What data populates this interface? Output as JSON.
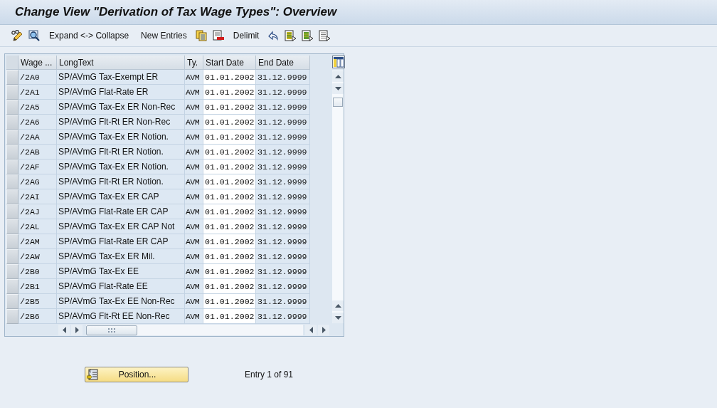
{
  "window": {
    "title": "Change View \"Derivation of Tax Wage Types\": Overview"
  },
  "toolbar": [
    "Expand <-> Collapse",
    "New Entries",
    "Delimit"
  ],
  "table": {
    "columns": [
      {
        "label": "Wage ...",
        "input": false
      },
      {
        "label": "LongText",
        "input": false
      },
      {
        "label": "Ty.",
        "input": false
      },
      {
        "label": "Start Date",
        "input": true
      },
      {
        "label": "End Date",
        "input": false
      }
    ],
    "rows": [
      {
        "selected": false,
        "cells": [
          "/2A0",
          "SP/AVmG Tax-Exempt ER",
          "AVM",
          "01.01.2002",
          "31.12.9999"
        ]
      },
      {
        "selected": false,
        "cells": [
          "/2A1",
          "SP/AVmG Flat-Rate ER",
          "AVM",
          "01.01.2002",
          "31.12.9999"
        ]
      },
      {
        "selected": false,
        "cells": [
          "/2A5",
          "SP/AVmG Tax-Ex ER Non-Rec",
          "AVM",
          "01.01.2002",
          "31.12.9999"
        ]
      },
      {
        "selected": false,
        "cells": [
          "/2A6",
          "SP/AVmG Flt-Rt ER Non-Rec",
          "AVM",
          "01.01.2002",
          "31.12.9999"
        ]
      },
      {
        "selected": false,
        "cells": [
          "/2AA",
          "SP/AVmG Tax-Ex ER Notion.",
          "AVM",
          "01.01.2002",
          "31.12.9999"
        ]
      },
      {
        "selected": false,
        "cells": [
          "/2AB",
          "SP/AVmG Flt-Rt ER Notion.",
          "AVM",
          "01.01.2002",
          "31.12.9999"
        ]
      },
      {
        "selected": false,
        "cells": [
          "/2AF",
          "SP/AVmG Tax-Ex ER Notion.",
          "AVM",
          "01.01.2002",
          "31.12.9999"
        ]
      },
      {
        "selected": false,
        "cells": [
          "/2AG",
          "SP/AVmG Flt-Rt ER Notion.",
          "AVM",
          "01.01.2002",
          "31.12.9999"
        ]
      },
      {
        "selected": false,
        "cells": [
          "/2AI",
          "SP/AVmG Tax-Ex ER CAP",
          "AVM",
          "01.01.2002",
          "31.12.9999"
        ]
      },
      {
        "selected": false,
        "cells": [
          "/2AJ",
          "SP/AVmG Flat-Rate ER CAP",
          "AVM",
          "01.01.2002",
          "31.12.9999"
        ]
      },
      {
        "selected": false,
        "cells": [
          "/2AL",
          "SP/AVmG Tax-Ex ER CAP Not",
          "AVM",
          "01.01.2002",
          "31.12.9999"
        ]
      },
      {
        "selected": false,
        "cells": [
          "/2AM",
          "SP/AVmG Flat-Rate ER CAP",
          "AVM",
          "01.01.2002",
          "31.12.9999"
        ]
      },
      {
        "selected": false,
        "cells": [
          "/2AW",
          "SP/AVmG Tax-Ex ER Mil.",
          "AVM",
          "01.01.2002",
          "31.12.9999"
        ]
      },
      {
        "selected": false,
        "cells": [
          "/2B0",
          "SP/AVmG Tax-Ex EE",
          "AVM",
          "01.01.2002",
          "31.12.9999"
        ]
      },
      {
        "selected": false,
        "cells": [
          "/2B1",
          "SP/AVmG Flat-Rate EE",
          "AVM",
          "01.01.2002",
          "31.12.9999"
        ]
      },
      {
        "selected": false,
        "cells": [
          "/2B5",
          "SP/AVmG Tax-Ex EE Non-Rec",
          "AVM",
          "01.01.2002",
          "31.12.9999"
        ]
      },
      {
        "selected": false,
        "cells": [
          "/2B6",
          "SP/AVmG Flt-Rt EE Non-Rec",
          "AVM",
          "01.01.2002",
          "31.12.9999"
        ]
      }
    ]
  },
  "footer": {
    "position_button": "Position...",
    "entry_info": "Entry 1 of 91"
  }
}
